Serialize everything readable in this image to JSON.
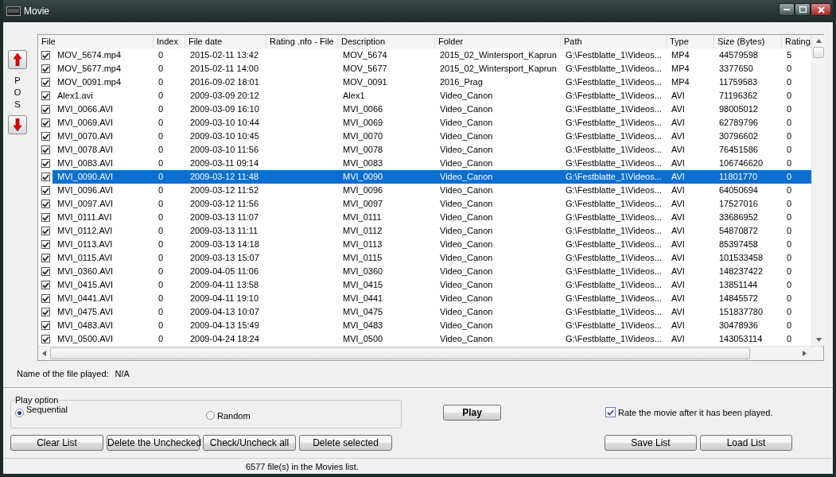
{
  "window": {
    "title": "Movie"
  },
  "pos_label": "POS",
  "table": {
    "columns": [
      "File",
      "Index",
      "File date",
      "Rating .nfo - File",
      "Description",
      "Folder",
      "Path",
      "Type",
      "Size (Bytes)",
      "Rating"
    ],
    "rows": [
      {
        "checked": true,
        "selected": false,
        "file": "MOV_5674.mp4",
        "index": "0",
        "date": "2015-02-11 13:42",
        "description": "MOV_5674",
        "folder": "2015_02_Wintersport_Kaprun",
        "path": "G:\\Festblatte_1\\Videos...",
        "type": "MP4",
        "size": "44579598",
        "rating": "5"
      },
      {
        "checked": true,
        "selected": false,
        "file": "MOV_5677.mp4",
        "index": "0",
        "date": "2015-02-11 14:00",
        "description": "MOV_5677",
        "folder": "2015_02_Wintersport_Kaprun",
        "path": "G:\\Festblatte_1\\Videos...",
        "type": "MP4",
        "size": "3377650",
        "rating": "0"
      },
      {
        "checked": true,
        "selected": false,
        "file": "MOV_0091.mp4",
        "index": "0",
        "date": "2016-09-02 18:01",
        "description": "MOV_0091",
        "folder": "2016_Prag",
        "path": "G:\\Festblatte_1\\Videos...",
        "type": "MP4",
        "size": "11759583",
        "rating": "0"
      },
      {
        "checked": true,
        "selected": false,
        "file": "Alex1.avi",
        "index": "0",
        "date": "2009-03-09 20:12",
        "description": "Alex1",
        "folder": "Video_Canon",
        "path": "G:\\Festblatte_1\\Videos...",
        "type": "AVI",
        "size": "71196362",
        "rating": "0"
      },
      {
        "checked": true,
        "selected": false,
        "file": "MVI_0066.AVI",
        "index": "0",
        "date": "2009-03-09 16:10",
        "description": "MVI_0066",
        "folder": "Video_Canon",
        "path": "G:\\Festblatte_1\\Videos...",
        "type": "AVI",
        "size": "98005012",
        "rating": "0"
      },
      {
        "checked": true,
        "selected": false,
        "file": "MVI_0069.AVI",
        "index": "0",
        "date": "2009-03-10 10:44",
        "description": "MVI_0069",
        "folder": "Video_Canon",
        "path": "G:\\Festblatte_1\\Videos...",
        "type": "AVI",
        "size": "62789796",
        "rating": "0"
      },
      {
        "checked": true,
        "selected": false,
        "file": "MVI_0070.AVI",
        "index": "0",
        "date": "2009-03-10 10:45",
        "description": "MVI_0070",
        "folder": "Video_Canon",
        "path": "G:\\Festblatte_1\\Videos...",
        "type": "AVI",
        "size": "30796602",
        "rating": "0"
      },
      {
        "checked": true,
        "selected": false,
        "file": "MVI_0078.AVI",
        "index": "0",
        "date": "2009-03-10 11:56",
        "description": "MVI_0078",
        "folder": "Video_Canon",
        "path": "G:\\Festblatte_1\\Videos...",
        "type": "AVI",
        "size": "76451586",
        "rating": "0"
      },
      {
        "checked": true,
        "selected": false,
        "file": "MVI_0083.AVI",
        "index": "0",
        "date": "2009-03-11 09:14",
        "description": "MVI_0083",
        "folder": "Video_Canon",
        "path": "G:\\Festblatte_1\\Videos...",
        "type": "AVI",
        "size": "106746620",
        "rating": "0"
      },
      {
        "checked": true,
        "selected": true,
        "file": "MVI_0090.AVI",
        "index": "0",
        "date": "2009-03-12 11:48",
        "description": "MVI_0090",
        "folder": "Video_Canon",
        "path": "G:\\Festblatte_1\\Videos...",
        "type": "AVI",
        "size": "11801770",
        "rating": "0"
      },
      {
        "checked": true,
        "selected": false,
        "file": "MVI_0096.AVI",
        "index": "0",
        "date": "2009-03-12 11:52",
        "description": "MVI_0096",
        "folder": "Video_Canon",
        "path": "G:\\Festblatte_1\\Videos...",
        "type": "AVI",
        "size": "64050694",
        "rating": "0"
      },
      {
        "checked": true,
        "selected": false,
        "file": "MVI_0097.AVI",
        "index": "0",
        "date": "2009-03-12 11:56",
        "description": "MVI_0097",
        "folder": "Video_Canon",
        "path": "G:\\Festblatte_1\\Videos...",
        "type": "AVI",
        "size": "17527016",
        "rating": "0"
      },
      {
        "checked": true,
        "selected": false,
        "file": "MVI_0111.AVI",
        "index": "0",
        "date": "2009-03-13 11:07",
        "description": "MVI_0111",
        "folder": "Video_Canon",
        "path": "G:\\Festblatte_1\\Videos...",
        "type": "AVI",
        "size": "33686952",
        "rating": "0"
      },
      {
        "checked": true,
        "selected": false,
        "file": "MVI_0112.AVI",
        "index": "0",
        "date": "2009-03-13 11:11",
        "description": "MVI_0112",
        "folder": "Video_Canon",
        "path": "G:\\Festblatte_1\\Videos...",
        "type": "AVI",
        "size": "54870872",
        "rating": "0"
      },
      {
        "checked": true,
        "selected": false,
        "file": "MVI_0113.AVI",
        "index": "0",
        "date": "2009-03-13 14:18",
        "description": "MVI_0113",
        "folder": "Video_Canon",
        "path": "G:\\Festblatte_1\\Videos...",
        "type": "AVI",
        "size": "85397458",
        "rating": "0"
      },
      {
        "checked": true,
        "selected": false,
        "file": "MVI_0115.AVI",
        "index": "0",
        "date": "2009-03-13 15:07",
        "description": "MVI_0115",
        "folder": "Video_Canon",
        "path": "G:\\Festblatte_1\\Videos...",
        "type": "AVI",
        "size": "101533458",
        "rating": "0"
      },
      {
        "checked": true,
        "selected": false,
        "file": "MVI_0360.AVI",
        "index": "0",
        "date": "2009-04-05 11:06",
        "description": "MVI_0360",
        "folder": "Video_Canon",
        "path": "G:\\Festblatte_1\\Videos...",
        "type": "AVI",
        "size": "148237422",
        "rating": "0"
      },
      {
        "checked": true,
        "selected": false,
        "file": "MVI_0415.AVI",
        "index": "0",
        "date": "2009-04-11 13:58",
        "description": "MVI_0415",
        "folder": "Video_Canon",
        "path": "G:\\Festblatte_1\\Videos...",
        "type": "AVI",
        "size": "13851144",
        "rating": "0"
      },
      {
        "checked": true,
        "selected": false,
        "file": "MVI_0441.AVI",
        "index": "0",
        "date": "2009-04-11 19:10",
        "description": "MVI_0441",
        "folder": "Video_Canon",
        "path": "G:\\Festblatte_1\\Videos...",
        "type": "AVI",
        "size": "14845572",
        "rating": "0"
      },
      {
        "checked": true,
        "selected": false,
        "file": "MVI_0475.AVI",
        "index": "0",
        "date": "2009-04-13 10:07",
        "description": "MVI_0475",
        "folder": "Video_Canon",
        "path": "G:\\Festblatte_1\\Videos...",
        "type": "AVI",
        "size": "151837780",
        "rating": "0"
      },
      {
        "checked": true,
        "selected": false,
        "file": "MVI_0483.AVI",
        "index": "0",
        "date": "2009-04-13 15:49",
        "description": "MVI_0483",
        "folder": "Video_Canon",
        "path": "G:\\Festblatte_1\\Videos...",
        "type": "AVI",
        "size": "30478936",
        "rating": "0"
      },
      {
        "checked": true,
        "selected": false,
        "file": "MVI_0500.AVI",
        "index": "0",
        "date": "2009-04-24 18:24",
        "description": "MVI_0500",
        "folder": "Video_Canon",
        "path": "G:\\Festblatte_1\\Videos...",
        "type": "AVI",
        "size": "143053114",
        "rating": "0"
      }
    ]
  },
  "now_playing": {
    "label": "Name of the file played:",
    "value": "N/A"
  },
  "play_option": {
    "title": "Play option",
    "options": [
      {
        "label": "Sequential",
        "selected": true
      },
      {
        "label": "Random",
        "selected": false
      }
    ]
  },
  "play_button": "Play",
  "rate_after_play": {
    "label": "Rate the movie after it has been played.",
    "checked": true
  },
  "left_buttons": [
    "Clear List",
    "Delete the Unchecked",
    "Check/Uncheck all",
    "Delete selected"
  ],
  "right_buttons": [
    "Save List",
    "Load List"
  ],
  "status_bar": "6577 file(s) in the Movies list."
}
